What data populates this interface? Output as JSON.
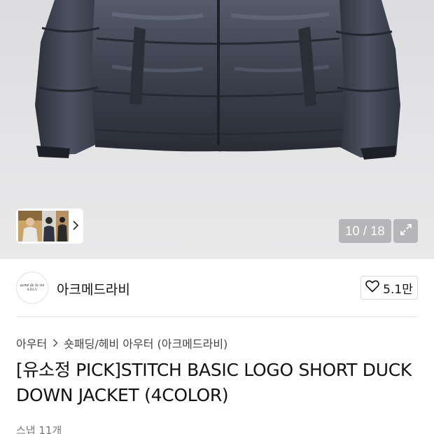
{
  "gallery": {
    "counter": "10 / 18",
    "image_alt": "Navy short duck down puffer jacket"
  },
  "brand": {
    "logo_line1": "acmé de la vie",
    "logo_line2": "ADLV",
    "name": "아크메드라비"
  },
  "like": {
    "count": "5.1만"
  },
  "breadcrumb": {
    "level1": "아우터",
    "level2": "숏패딩/헤비 아우터 (아크메드라비)"
  },
  "product": {
    "title": "[유소정 PICK]STITCH BASIC LOGO SHORT DUCK DOWN JACKET (4COLOR)",
    "subtext": "스냅 11개"
  },
  "colors": {
    "jacket": "#3d4250",
    "background": "#e4e4e6"
  }
}
